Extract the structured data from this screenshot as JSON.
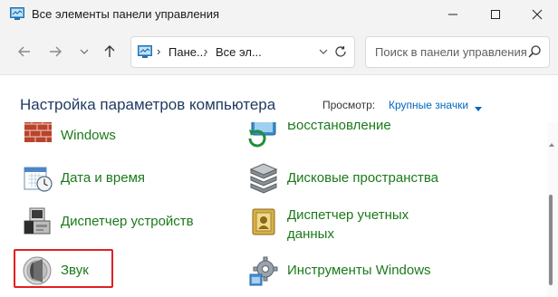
{
  "window": {
    "title": "Все элементы панели управления"
  },
  "nav": {
    "breadcrumbs": [
      "Пане...",
      "Все эл..."
    ]
  },
  "search": {
    "placeholder": "Поиск в панели управления"
  },
  "content": {
    "heading": "Настройка параметров компьютера",
    "view_label": "Просмотр:",
    "view_value": "Крупные значки"
  },
  "items": [
    {
      "label": "Windows",
      "icon": "firewall-brick-icon"
    },
    {
      "label": "Восстановление",
      "icon": "recovery-icon"
    },
    {
      "label": "Дата и время",
      "icon": "calendar-clock-icon"
    },
    {
      "label": "Дисковые пространства",
      "icon": "storage-spaces-icon"
    },
    {
      "label": "Диспетчер устройств",
      "icon": "device-manager-icon"
    },
    {
      "label": "Диспетчер учетных данных",
      "line1": "Диспетчер учетных",
      "line2": "данных",
      "icon": "credential-manager-icon"
    },
    {
      "label": "Звук",
      "icon": "speaker-icon"
    },
    {
      "label": "Инструменты Windows",
      "icon": "windows-tools-icon"
    }
  ],
  "colors": {
    "link_green": "#1a7a1a",
    "heading_blue": "#1e3a5f",
    "accent": "#0067c0",
    "highlight_red": "#e02020"
  }
}
